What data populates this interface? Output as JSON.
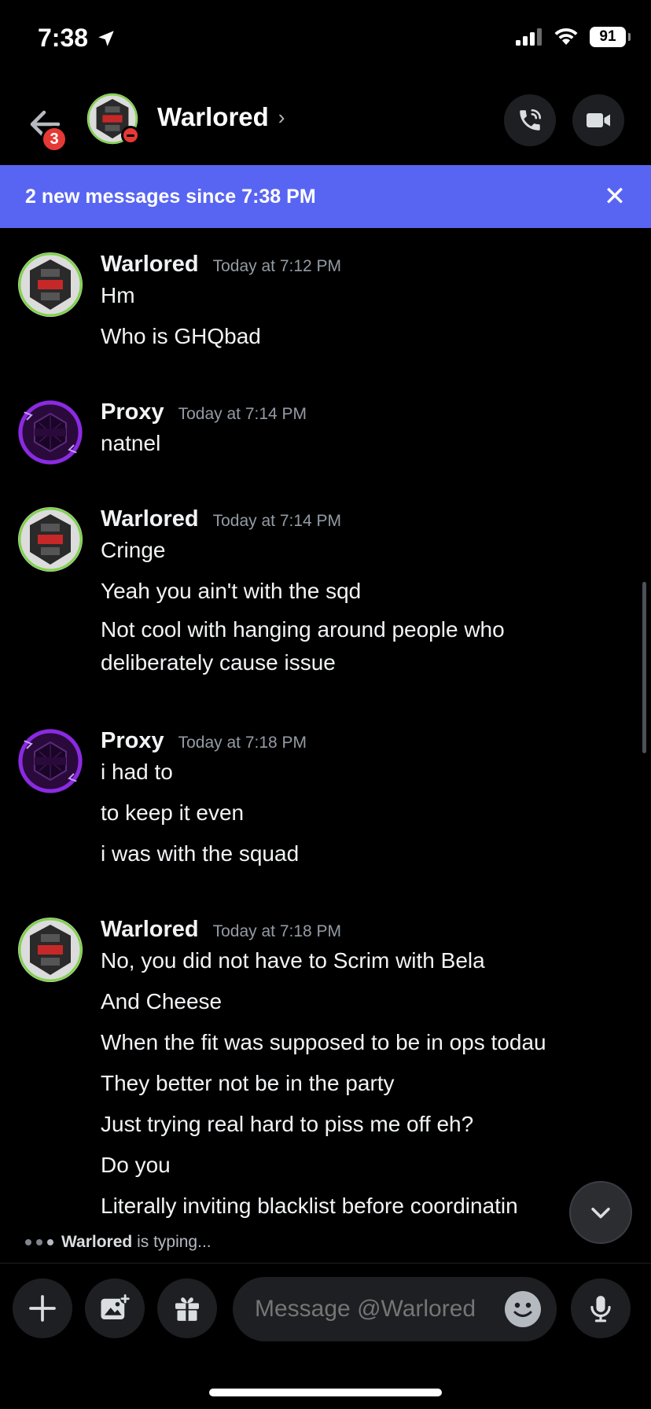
{
  "status_bar": {
    "time": "7:38",
    "battery": "91"
  },
  "header": {
    "back_badge": "3",
    "name": "Warlored",
    "chevron": "›"
  },
  "banner": {
    "text": "2 new messages since 7:38 PM",
    "close": "✕"
  },
  "messages": [
    {
      "author": "Warlored",
      "time": "Today at 7:12 PM",
      "avatar": "warlored",
      "lines": [
        "Hm",
        "Who is GHQbad"
      ]
    },
    {
      "author": "Proxy",
      "time": "Today at 7:14 PM",
      "avatar": "proxy",
      "lines": [
        "natnel"
      ]
    },
    {
      "author": "Warlored",
      "time": "Today at 7:14 PM",
      "avatar": "warlored",
      "lines": [
        "Cringe",
        "Yeah you ain't with the sqd",
        "Not cool with hanging around people who deliberately cause issue"
      ]
    },
    {
      "author": "Proxy",
      "time": "Today at 7:18 PM",
      "avatar": "proxy",
      "lines": [
        "i had to",
        "to keep it even",
        "i was with the squad"
      ]
    },
    {
      "author": "Warlored",
      "time": "Today at 7:18 PM",
      "avatar": "warlored",
      "lines": [
        "No, you did not have to Scrim with Bela",
        "And Cheese",
        "When the fit was supposed to be in ops todau",
        "They better not be in the party",
        "Just trying real hard to piss me off eh?",
        "Do you",
        "Literally inviting blacklist before coordinatin"
      ]
    }
  ],
  "typing": {
    "user": "Warlored",
    "suffix": "is typing..."
  },
  "input": {
    "placeholder": "Message @Warlored"
  },
  "colors": {
    "accent": "#5865f2",
    "background": "#000000",
    "dnd": "#e53935",
    "proxy_avatar": "#8a2be2",
    "warlored_ring": "#7fd34a"
  }
}
